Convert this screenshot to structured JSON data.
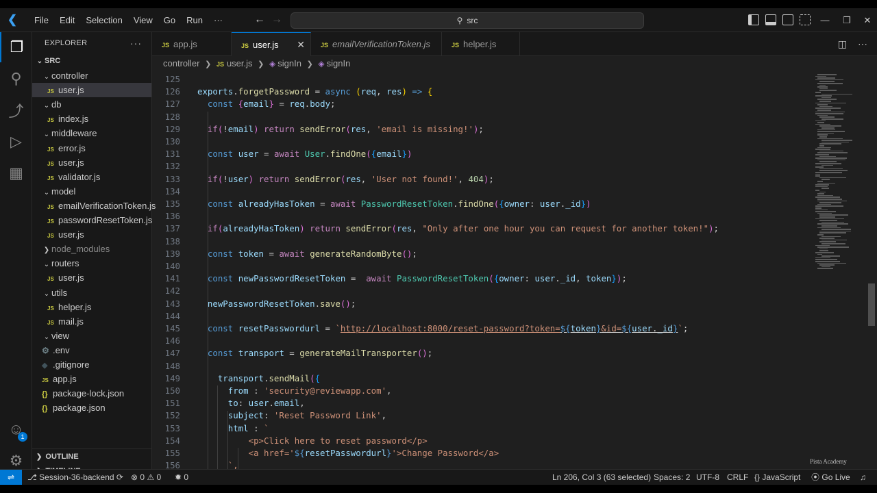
{
  "titlebar": {
    "menu": [
      "File",
      "Edit",
      "Selection",
      "View",
      "Go",
      "Run",
      "···"
    ],
    "search": "src"
  },
  "sidebar": {
    "title": "EXPLORER",
    "root": "SRC",
    "tree": [
      {
        "label": "controller",
        "type": "folder",
        "level": 1
      },
      {
        "label": "user.js",
        "type": "js",
        "level": 2,
        "selected": true
      },
      {
        "label": "db",
        "type": "folder",
        "level": 1
      },
      {
        "label": "index.js",
        "type": "js",
        "level": 2
      },
      {
        "label": "middleware",
        "type": "folder",
        "level": 1
      },
      {
        "label": "error.js",
        "type": "js",
        "level": 2
      },
      {
        "label": "user.js",
        "type": "js",
        "level": 2
      },
      {
        "label": "validator.js",
        "type": "js",
        "level": 2
      },
      {
        "label": "model",
        "type": "folder",
        "level": 1
      },
      {
        "label": "emailVerificationToken.js",
        "type": "js",
        "level": 2
      },
      {
        "label": "passwordResetToken.js",
        "type": "js",
        "level": 2
      },
      {
        "label": "user.js",
        "type": "js",
        "level": 2
      },
      {
        "label": "node_modules",
        "type": "folder-closed",
        "level": 1
      },
      {
        "label": "routers",
        "type": "folder",
        "level": 1
      },
      {
        "label": "user.js",
        "type": "js",
        "level": 2
      },
      {
        "label": "utils",
        "type": "folder",
        "level": 1
      },
      {
        "label": "helper.js",
        "type": "js",
        "level": 2
      },
      {
        "label": "mail.js",
        "type": "js",
        "level": 2
      },
      {
        "label": "view",
        "type": "folder",
        "level": 1
      },
      {
        "label": ".env",
        "type": "env",
        "level": 1
      },
      {
        "label": ".gitignore",
        "type": "git",
        "level": 1
      },
      {
        "label": "app.js",
        "type": "js",
        "level": 1
      },
      {
        "label": "package-lock.json",
        "type": "json",
        "level": 1
      },
      {
        "label": "package.json",
        "type": "json",
        "level": 1
      }
    ],
    "outline": "OUTLINE",
    "timeline": "TIMELINE",
    "accounts_badge": "1"
  },
  "tabs": [
    {
      "label": "app.js",
      "active": false
    },
    {
      "label": "user.js",
      "active": true
    },
    {
      "label": "emailVerificationToken.js",
      "active": false,
      "italic": true
    },
    {
      "label": "helper.js",
      "active": false
    }
  ],
  "breadcrumb": [
    "controller",
    "user.js",
    "signIn",
    "signIn"
  ],
  "code": {
    "line_numbers": [
      "125",
      "126",
      "127",
      "128",
      "129",
      "130",
      "131",
      "132",
      "133",
      "134",
      "135",
      "136",
      "137",
      "138",
      "139",
      "140",
      "141",
      "142",
      "143",
      "144",
      "145",
      "146",
      "147",
      "148",
      "149",
      "150",
      "151",
      "152",
      "153",
      "154",
      "155",
      "156"
    ]
  },
  "watermark": "Pista Academy",
  "statusbar": {
    "branch": "Session-36-backend",
    "errors": "0",
    "warnings": "0",
    "ports": "0",
    "position": "Ln 206, Col 3 (63 selected)",
    "spaces": "Spaces: 2",
    "encoding": "UTF-8",
    "eol": "CRLF",
    "language": "JavaScript",
    "golive": "Go Live"
  }
}
